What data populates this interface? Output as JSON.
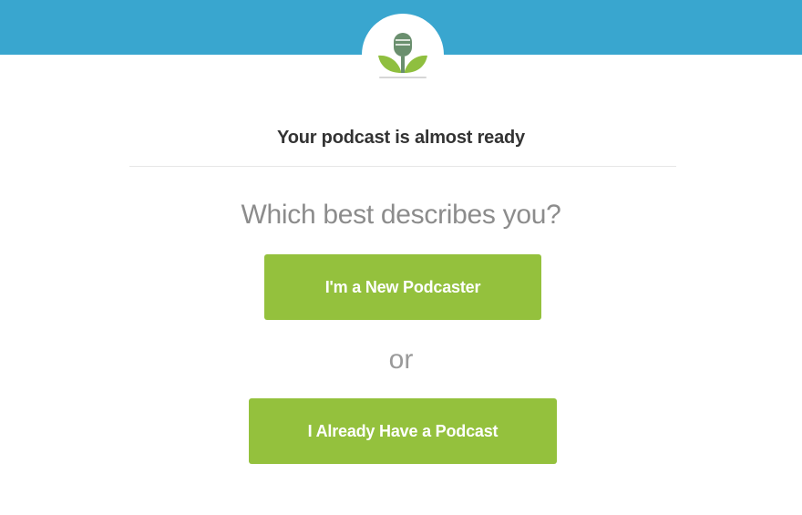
{
  "header": {
    "logo_icon": "podcast-plant-microphone-icon",
    "band_color": "#39a6cf",
    "accent_color": "#94c13d"
  },
  "main": {
    "heading": "Your podcast is almost ready",
    "question": "Which best describes you?",
    "new_podcaster_button": "I'm a New Podcaster",
    "separator": "or",
    "existing_podcast_button": "I Already Have a Podcast"
  }
}
